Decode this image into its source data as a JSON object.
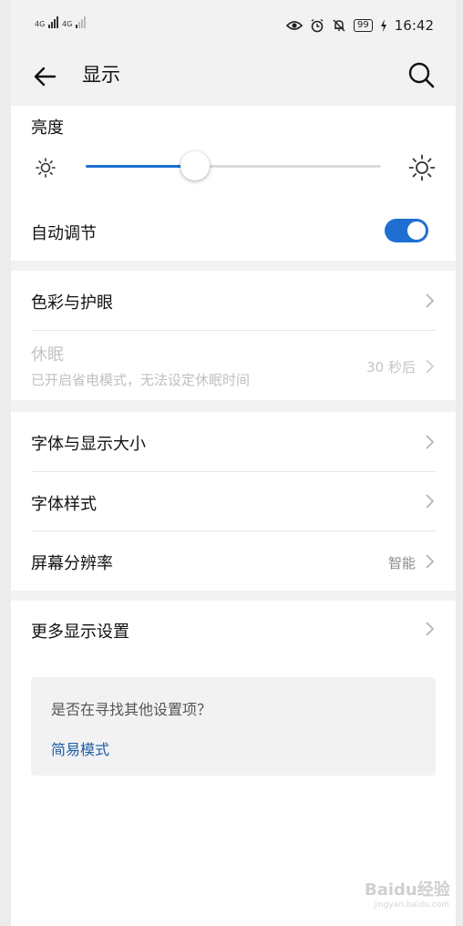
{
  "status_bar": {
    "signal_1": "4G",
    "signal_2": "4G",
    "battery": "99",
    "time": "16:42",
    "icons": [
      "eye-comfort-icon",
      "alarm-icon",
      "mute-bell-icon",
      "battery-icon",
      "charging-icon"
    ]
  },
  "header": {
    "title": "显示",
    "back_icon": "arrow-left-icon",
    "search_icon": "search-icon"
  },
  "brightness": {
    "label": "亮度",
    "level": 0.37,
    "auto_label": "自动调节",
    "auto_on": true
  },
  "group1": {
    "color_eye": "色彩与护眼",
    "sleep_label": "休眠",
    "sleep_sub": "已开启省电模式，无法设定休眠时间",
    "sleep_value": "30 秒后"
  },
  "group2": {
    "font_size": "字体与显示大小",
    "font_style": "字体样式",
    "resolution": "屏幕分辨率",
    "resolution_value": "智能"
  },
  "group3": {
    "more": "更多显示设置"
  },
  "suggest": {
    "question": "是否在寻找其他设置项？",
    "link": "简易模式"
  },
  "watermark": {
    "text": "Baidu经验",
    "sub": "jingyan.baidu.com"
  },
  "colors": {
    "accent": "#1e6fd1",
    "link": "#1f5ea8"
  }
}
